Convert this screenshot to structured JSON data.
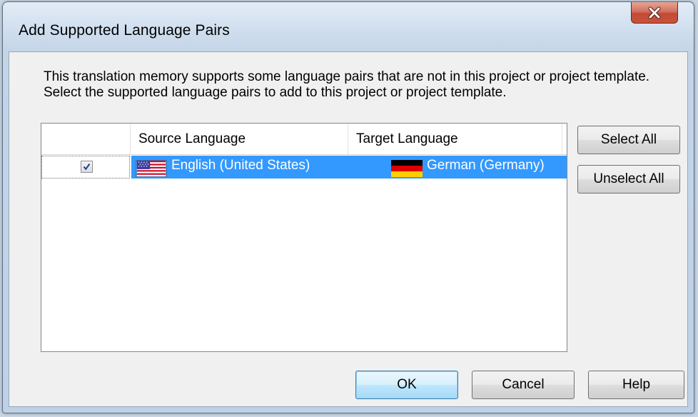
{
  "window": {
    "title": "Add Supported Language Pairs"
  },
  "description": "This translation memory supports some language pairs that are not in this project or project template. Select the supported language pairs to add to this project or project template.",
  "list": {
    "columns": [
      "",
      "Source Language",
      "Target Language"
    ],
    "rows": [
      {
        "checked": true,
        "selected": true,
        "source": "English (United States)",
        "source_flag": "us-flag-icon",
        "target": "German (Germany)",
        "target_flag": "germany-flag-icon"
      }
    ]
  },
  "side_buttons": {
    "select_all": "Select All",
    "unselect_all": "Unselect All"
  },
  "footer_buttons": {
    "ok": "OK",
    "cancel": "Cancel",
    "help": "Help"
  },
  "colors": {
    "selection": "#3399ff",
    "close_button": "#c44a34"
  }
}
